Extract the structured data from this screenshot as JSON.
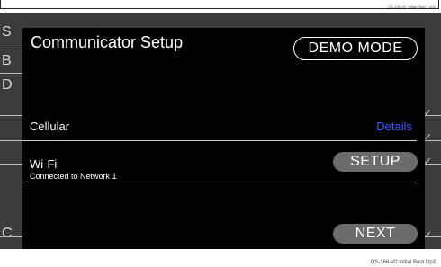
{
  "ref_codes": {
    "top": "QS-165-V0_Initial_Boo t_Up2",
    "bottom": "QS-166-V0 Initial Boot Up3"
  },
  "background": {
    "letters": [
      "S",
      "B",
      "D",
      "C"
    ]
  },
  "dialog": {
    "title": "Communicator Setup",
    "mode_button": "DEMO MODE",
    "rows": [
      {
        "label": "Cellular",
        "action": "Details"
      },
      {
        "label": "Wi-Fi",
        "sublabel": "Connected to Network 1",
        "action": "SETUP"
      }
    ],
    "next_button": "NEXT"
  },
  "colors": {
    "link": "#3d5cff",
    "pill": "#6b6b6b",
    "dialog_bg": "#000000",
    "screen_bg": "#3c3c3c"
  },
  "icons": [
    "checkmark-icon"
  ]
}
